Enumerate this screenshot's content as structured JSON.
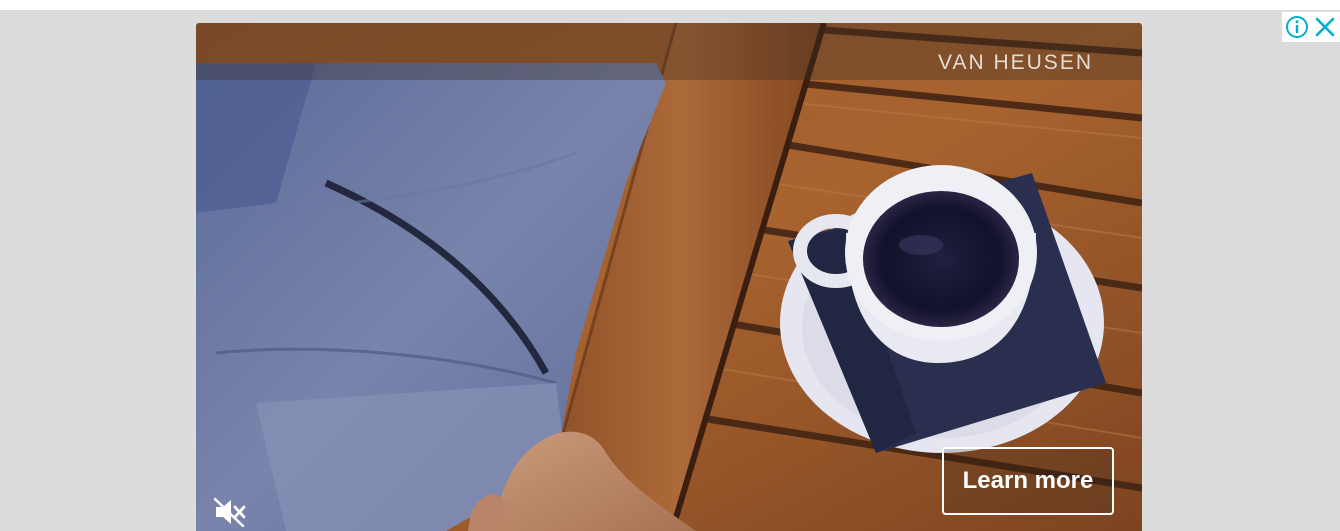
{
  "ad": {
    "brand": "VAN HEUSEN",
    "cta_label": "Learn more",
    "mute_icon": "muted-speaker-icon",
    "info_icon": "info-icon",
    "close_icon": "close-icon",
    "accent_color": "#00aecd"
  }
}
